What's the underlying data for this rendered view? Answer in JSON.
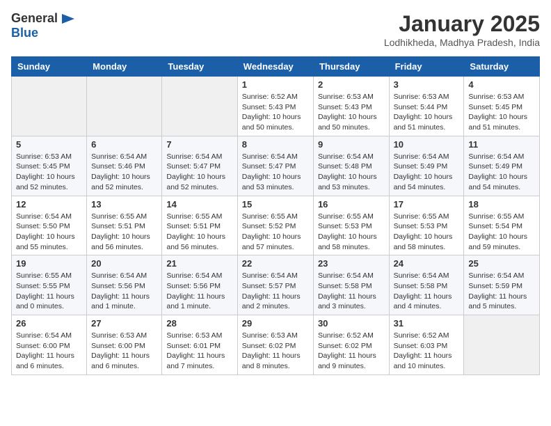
{
  "header": {
    "logo_general": "General",
    "logo_blue": "Blue",
    "title": "January 2025",
    "subtitle": "Lodhikheda, Madhya Pradesh, India"
  },
  "days_of_week": [
    "Sunday",
    "Monday",
    "Tuesday",
    "Wednesday",
    "Thursday",
    "Friday",
    "Saturday"
  ],
  "weeks": [
    [
      {
        "day": "",
        "info": ""
      },
      {
        "day": "",
        "info": ""
      },
      {
        "day": "",
        "info": ""
      },
      {
        "day": "1",
        "info": "Sunrise: 6:52 AM\nSunset: 5:43 PM\nDaylight: 10 hours\nand 50 minutes."
      },
      {
        "day": "2",
        "info": "Sunrise: 6:53 AM\nSunset: 5:43 PM\nDaylight: 10 hours\nand 50 minutes."
      },
      {
        "day": "3",
        "info": "Sunrise: 6:53 AM\nSunset: 5:44 PM\nDaylight: 10 hours\nand 51 minutes."
      },
      {
        "day": "4",
        "info": "Sunrise: 6:53 AM\nSunset: 5:45 PM\nDaylight: 10 hours\nand 51 minutes."
      }
    ],
    [
      {
        "day": "5",
        "info": "Sunrise: 6:53 AM\nSunset: 5:45 PM\nDaylight: 10 hours\nand 52 minutes."
      },
      {
        "day": "6",
        "info": "Sunrise: 6:54 AM\nSunset: 5:46 PM\nDaylight: 10 hours\nand 52 minutes."
      },
      {
        "day": "7",
        "info": "Sunrise: 6:54 AM\nSunset: 5:47 PM\nDaylight: 10 hours\nand 52 minutes."
      },
      {
        "day": "8",
        "info": "Sunrise: 6:54 AM\nSunset: 5:47 PM\nDaylight: 10 hours\nand 53 minutes."
      },
      {
        "day": "9",
        "info": "Sunrise: 6:54 AM\nSunset: 5:48 PM\nDaylight: 10 hours\nand 53 minutes."
      },
      {
        "day": "10",
        "info": "Sunrise: 6:54 AM\nSunset: 5:49 PM\nDaylight: 10 hours\nand 54 minutes."
      },
      {
        "day": "11",
        "info": "Sunrise: 6:54 AM\nSunset: 5:49 PM\nDaylight: 10 hours\nand 54 minutes."
      }
    ],
    [
      {
        "day": "12",
        "info": "Sunrise: 6:54 AM\nSunset: 5:50 PM\nDaylight: 10 hours\nand 55 minutes."
      },
      {
        "day": "13",
        "info": "Sunrise: 6:55 AM\nSunset: 5:51 PM\nDaylight: 10 hours\nand 56 minutes."
      },
      {
        "day": "14",
        "info": "Sunrise: 6:55 AM\nSunset: 5:51 PM\nDaylight: 10 hours\nand 56 minutes."
      },
      {
        "day": "15",
        "info": "Sunrise: 6:55 AM\nSunset: 5:52 PM\nDaylight: 10 hours\nand 57 minutes."
      },
      {
        "day": "16",
        "info": "Sunrise: 6:55 AM\nSunset: 5:53 PM\nDaylight: 10 hours\nand 58 minutes."
      },
      {
        "day": "17",
        "info": "Sunrise: 6:55 AM\nSunset: 5:53 PM\nDaylight: 10 hours\nand 58 minutes."
      },
      {
        "day": "18",
        "info": "Sunrise: 6:55 AM\nSunset: 5:54 PM\nDaylight: 10 hours\nand 59 minutes."
      }
    ],
    [
      {
        "day": "19",
        "info": "Sunrise: 6:55 AM\nSunset: 5:55 PM\nDaylight: 11 hours\nand 0 minutes."
      },
      {
        "day": "20",
        "info": "Sunrise: 6:54 AM\nSunset: 5:56 PM\nDaylight: 11 hours\nand 1 minute."
      },
      {
        "day": "21",
        "info": "Sunrise: 6:54 AM\nSunset: 5:56 PM\nDaylight: 11 hours\nand 1 minute."
      },
      {
        "day": "22",
        "info": "Sunrise: 6:54 AM\nSunset: 5:57 PM\nDaylight: 11 hours\nand 2 minutes."
      },
      {
        "day": "23",
        "info": "Sunrise: 6:54 AM\nSunset: 5:58 PM\nDaylight: 11 hours\nand 3 minutes."
      },
      {
        "day": "24",
        "info": "Sunrise: 6:54 AM\nSunset: 5:58 PM\nDaylight: 11 hours\nand 4 minutes."
      },
      {
        "day": "25",
        "info": "Sunrise: 6:54 AM\nSunset: 5:59 PM\nDaylight: 11 hours\nand 5 minutes."
      }
    ],
    [
      {
        "day": "26",
        "info": "Sunrise: 6:54 AM\nSunset: 6:00 PM\nDaylight: 11 hours\nand 6 minutes."
      },
      {
        "day": "27",
        "info": "Sunrise: 6:53 AM\nSunset: 6:00 PM\nDaylight: 11 hours\nand 6 minutes."
      },
      {
        "day": "28",
        "info": "Sunrise: 6:53 AM\nSunset: 6:01 PM\nDaylight: 11 hours\nand 7 minutes."
      },
      {
        "day": "29",
        "info": "Sunrise: 6:53 AM\nSunset: 6:02 PM\nDaylight: 11 hours\nand 8 minutes."
      },
      {
        "day": "30",
        "info": "Sunrise: 6:52 AM\nSunset: 6:02 PM\nDaylight: 11 hours\nand 9 minutes."
      },
      {
        "day": "31",
        "info": "Sunrise: 6:52 AM\nSunset: 6:03 PM\nDaylight: 11 hours\nand 10 minutes."
      },
      {
        "day": "",
        "info": ""
      }
    ]
  ]
}
